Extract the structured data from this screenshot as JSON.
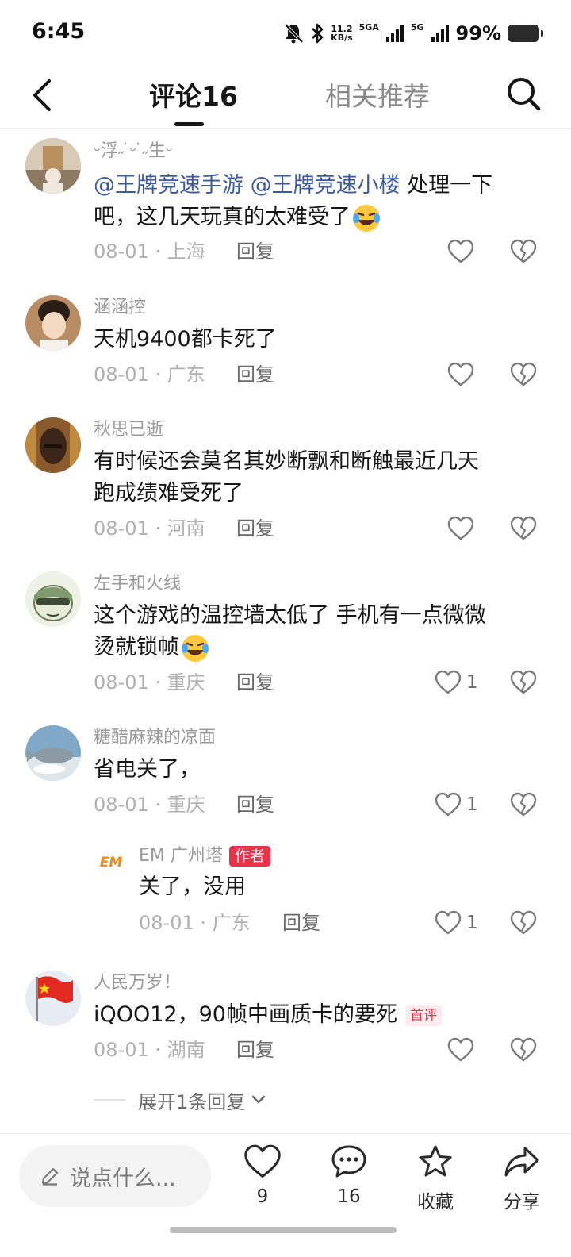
{
  "status_bar": {
    "time": "6:45",
    "net_speed_value": "11.2",
    "net_speed_unit": "KB/s",
    "sim1_label": "5GA",
    "sim2_label": "5G",
    "battery": "99%"
  },
  "header": {
    "tab_comments": "评论16",
    "tab_related": "相关推荐"
  },
  "comments": [
    {
      "user": "ᵕ浮˶ ̇ᵕ ̇˶生ᵕ",
      "mention1": "@王牌竞速手游",
      "mention2": "@王牌竞速小楼",
      "text_line1": "处理一下",
      "text_line2": "吧，这几天玩真的太难受了",
      "date_location": "08-01 · 上海",
      "reply": "回复",
      "likes": ""
    },
    {
      "user": "涵涵控",
      "text_line1": "天机9400都卡死了",
      "date_location": "08-01 · 广东",
      "reply": "回复",
      "likes": ""
    },
    {
      "user": "秋思已逝",
      "text_line1": "有时候还会莫名其妙断飘和断触最近几天",
      "text_line2": "跑成绩难受死了",
      "date_location": "08-01 · 河南",
      "reply": "回复",
      "likes": ""
    },
    {
      "user": "左手和火线",
      "text_line1": "这个游戏的温控墙太低了  手机有一点微微",
      "text_line2": "烫就锁帧",
      "date_location": "08-01 · 重庆",
      "reply": "回复",
      "likes": "1"
    },
    {
      "user": "糖醋麻辣的凉面",
      "text_line1": "省电关了，",
      "date_location": "08-01 · 重庆",
      "reply": "回复",
      "likes": "1"
    },
    {
      "user": "EM 广州塔",
      "badge": "作者",
      "avatar_text": "EM",
      "text_line1": "关了，没用",
      "date_location": "08-01 · 广东",
      "reply": "回复",
      "likes": "1"
    },
    {
      "user": "人民万岁！",
      "text_line1": "iQOO12，90帧中画质卡的要死",
      "badge": "首评",
      "date_location": "08-01 · 湖南",
      "reply": "回复",
      "likes": ""
    }
  ],
  "expand_replies": "展开1条回复",
  "bottom_bar": {
    "input_placeholder": "说点什么...",
    "like_count": "9",
    "comment_count": "16",
    "favorite_label": "收藏",
    "share_label": "分享"
  },
  "colors": {
    "mention": "#3b5a9e",
    "author_badge": "#e8334a",
    "text": "#161616",
    "meta": "#b0b0b0"
  }
}
